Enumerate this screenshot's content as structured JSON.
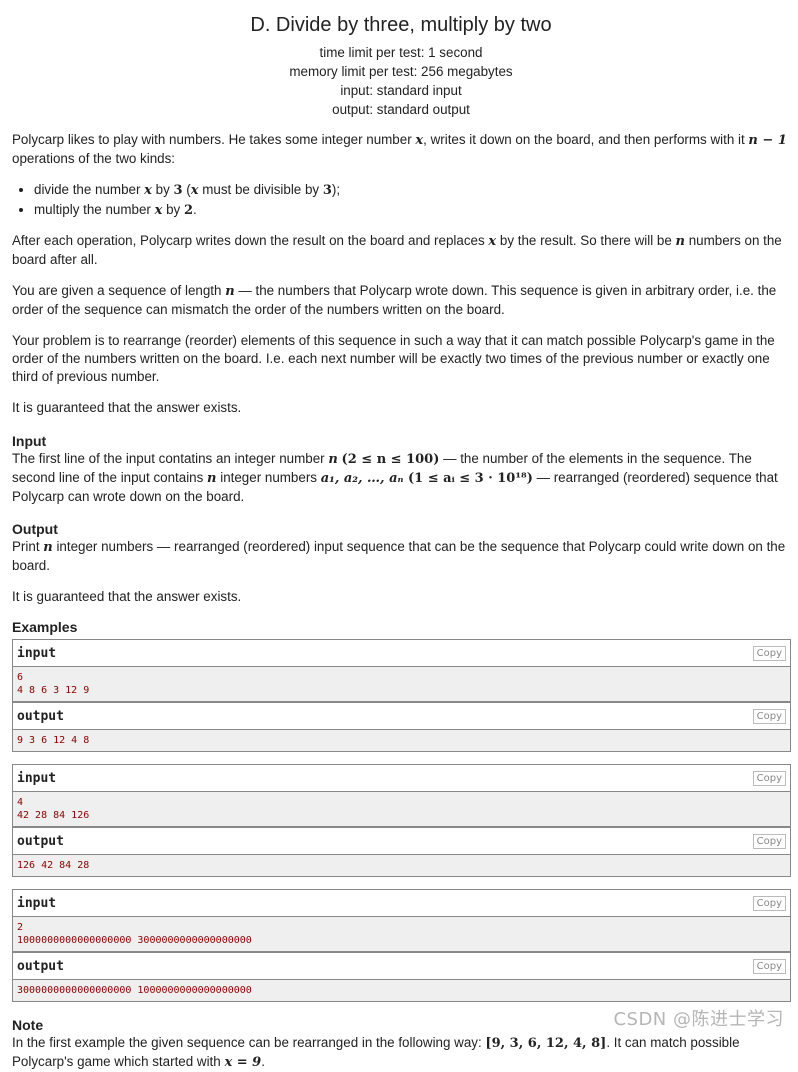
{
  "header": {
    "title": "D. Divide by three, multiply by two",
    "time_limit": "time limit per test: 1 second",
    "memory_limit": "memory limit per test: 256 megabytes",
    "input": "input: standard input",
    "output": "output: standard output"
  },
  "statement": {
    "p1_a": "Polycarp likes to play with numbers. He takes some integer number ",
    "p1_x": "x",
    "p1_b": ", writes it down on the board, and then performs with it ",
    "p1_math": "n − 1",
    "p1_c": " operations of the two kinds:",
    "bullets": [
      {
        "a": "divide the number ",
        "x": "x",
        "b": " by ",
        "n": "3",
        "c": " (",
        "x2": "x",
        "d": " must be divisible by ",
        "n2": "3",
        "e": ");"
      },
      {
        "a": "multiply the number ",
        "x": "x",
        "b": " by ",
        "n": "2",
        "c": "."
      }
    ],
    "p2_a": "After each operation, Polycarp writes down the result on the board and replaces ",
    "p2_x": "x",
    "p2_b": " by the result. So there will be ",
    "p2_n": "n",
    "p2_c": " numbers on the board after all.",
    "p3_a": "You are given a sequence of length ",
    "p3_n": "n",
    "p3_b": " — the numbers that Polycarp wrote down. This sequence is given in arbitrary order, i.e. the order of the sequence can mismatch the order of the numbers written on the board.",
    "p4": "Your problem is to rearrange (reorder) elements of this sequence in such a way that it can match possible Polycarp's game in the order of the numbers written on the board. I.e. each next number will be exactly two times of the previous number or exactly one third of previous number.",
    "p5": "It is guaranteed that the answer exists."
  },
  "input_section": {
    "title": "Input",
    "a": "The first line of the input contatins an integer number ",
    "n": "n",
    "range1": "(2 ≤ n ≤ 100)",
    "b": " — the number of the elements in the sequence. The second line of the input contains ",
    "n2": "n",
    "c": " integer numbers ",
    "seq": "a₁, a₂, …, aₙ",
    "range2": " (1 ≤ aᵢ ≤ 3 · 10¹⁸)",
    "d": " — rearranged (reordered) sequence that Polycarp can wrote down on the board."
  },
  "output_section": {
    "title": "Output",
    "a": "Print ",
    "n": "n",
    "b": " integer numbers — rearranged (reordered) input sequence that can be the sequence that Polycarp could write down on the board.",
    "guarantee": "It is guaranteed that the answer exists."
  },
  "examples": {
    "title": "Examples",
    "input_label": "input",
    "output_label": "output",
    "copy_label": "Copy",
    "items": [
      {
        "input": [
          "6",
          "4 8 6 3 12 9"
        ],
        "output": [
          "9 3 6 12 4 8"
        ]
      },
      {
        "input": [
          "4",
          "42 28 84 126"
        ],
        "output": [
          "126 42 84 28"
        ]
      },
      {
        "input": [
          "2",
          "1000000000000000000 3000000000000000000"
        ],
        "output": [
          "3000000000000000000 1000000000000000000"
        ]
      }
    ]
  },
  "note": {
    "title": "Note",
    "a": "In the first example the given sequence can be rearranged in the following way: ",
    "seq": "[9, 3, 6, 12, 4, 8]",
    "b": ". It can match possible Polycarp's game which started with ",
    "eq": "x = 9",
    "c": "."
  },
  "watermark": "CSDN @陈进士学习"
}
